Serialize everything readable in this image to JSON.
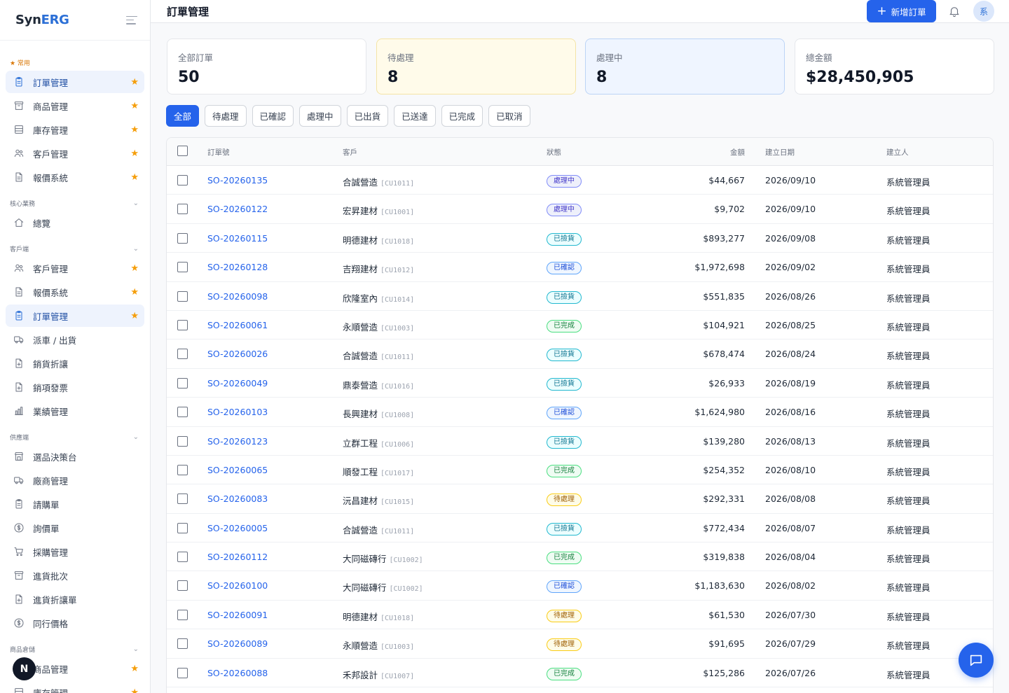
{
  "brand": {
    "prefix": "Syn",
    "accent": "ERG"
  },
  "header": {
    "title": "訂單管理",
    "new_button": "新增訂單",
    "avatar": "系"
  },
  "sidebar": {
    "favorites_title": "★ 常用",
    "favorites": [
      {
        "label": "訂單管理",
        "icon": "clipboard-icon",
        "active": true
      },
      {
        "label": "商品管理",
        "icon": "archive-icon"
      },
      {
        "label": "庫存管理",
        "icon": "warehouse-icon"
      },
      {
        "label": "客戶管理",
        "icon": "users-icon"
      },
      {
        "label": "報價系統",
        "icon": "document-icon"
      }
    ],
    "sections": [
      {
        "title": "核心業務",
        "items": [
          {
            "label": "總覽",
            "icon": "home-icon"
          }
        ]
      },
      {
        "title": "客戶端",
        "items": [
          {
            "label": "客戶管理",
            "icon": "users-icon",
            "star": true
          },
          {
            "label": "報價系統",
            "icon": "document-icon",
            "star": true
          },
          {
            "label": "訂單管理",
            "icon": "clipboard-icon",
            "star": true,
            "active": true
          },
          {
            "label": "派車 / 出貨",
            "icon": "truck-icon"
          },
          {
            "label": "銷貨折讓",
            "icon": "document-plus-icon"
          },
          {
            "label": "銷項發票",
            "icon": "document-plus-icon"
          },
          {
            "label": "業績管理",
            "icon": "bar-chart-icon"
          }
        ]
      },
      {
        "title": "供應端",
        "items": [
          {
            "label": "選品決策台",
            "icon": "store-icon"
          },
          {
            "label": "廠商管理",
            "icon": "truck-icon"
          },
          {
            "label": "請購單",
            "icon": "clipboard-icon"
          },
          {
            "label": "詢價單",
            "icon": "dollar-icon"
          },
          {
            "label": "採購管理",
            "icon": "cart-icon"
          },
          {
            "label": "進貨批次",
            "icon": "archive-icon"
          },
          {
            "label": "進貨折讓單",
            "icon": "document-plus-icon"
          },
          {
            "label": "同行價格",
            "icon": "dollar-icon"
          }
        ]
      },
      {
        "title": "商品倉儲",
        "items": [
          {
            "label": "商品管理",
            "icon": "archive-icon",
            "star": true
          },
          {
            "label": "庫存管理",
            "icon": "warehouse-icon",
            "star": true
          }
        ]
      }
    ],
    "bubble": "N"
  },
  "stats": [
    {
      "label": "全部訂單",
      "value": "50"
    },
    {
      "label": "待處理",
      "value": "8"
    },
    {
      "label": "處理中",
      "value": "8"
    },
    {
      "label": "總金額",
      "value": "$28,450,905"
    }
  ],
  "filters": [
    "全部",
    "待處理",
    "已確認",
    "處理中",
    "已出貨",
    "已送達",
    "已完成",
    "已取消"
  ],
  "table": {
    "columns": {
      "order": "訂單號",
      "customer": "客戶",
      "status": "狀態",
      "amount": "金額",
      "date": "建立日期",
      "creator": "建立人"
    },
    "rows": [
      {
        "order": "SO-20260135",
        "customer": "合誠營造",
        "code": "[CU1011]",
        "status": "處理中",
        "amount": "$44,667",
        "date": "2026/09/10",
        "creator": "系統管理員"
      },
      {
        "order": "SO-20260122",
        "customer": "宏昇建材",
        "code": "[CU1001]",
        "status": "處理中",
        "amount": "$9,702",
        "date": "2026/09/10",
        "creator": "系統管理員"
      },
      {
        "order": "SO-20260115",
        "customer": "明德建材",
        "code": "[CU1018]",
        "status": "已撿貨",
        "amount": "$893,277",
        "date": "2026/09/08",
        "creator": "系統管理員"
      },
      {
        "order": "SO-20260128",
        "customer": "吉翔建材",
        "code": "[CU1012]",
        "status": "已確認",
        "amount": "$1,972,698",
        "date": "2026/09/02",
        "creator": "系統管理員"
      },
      {
        "order": "SO-20260098",
        "customer": "欣隆室內",
        "code": "[CU1014]",
        "status": "已撿貨",
        "amount": "$551,835",
        "date": "2026/08/26",
        "creator": "系統管理員"
      },
      {
        "order": "SO-20260061",
        "customer": "永順營造",
        "code": "[CU1003]",
        "status": "已完成",
        "amount": "$104,921",
        "date": "2026/08/25",
        "creator": "系統管理員"
      },
      {
        "order": "SO-20260026",
        "customer": "合誠營造",
        "code": "[CU1011]",
        "status": "已撿貨",
        "amount": "$678,474",
        "date": "2026/08/24",
        "creator": "系統管理員"
      },
      {
        "order": "SO-20260049",
        "customer": "鼎泰營造",
        "code": "[CU1016]",
        "status": "已撿貨",
        "amount": "$26,933",
        "date": "2026/08/19",
        "creator": "系統管理員"
      },
      {
        "order": "SO-20260103",
        "customer": "長興建材",
        "code": "[CU1008]",
        "status": "已確認",
        "amount": "$1,624,980",
        "date": "2026/08/16",
        "creator": "系統管理員"
      },
      {
        "order": "SO-20260123",
        "customer": "立群工程",
        "code": "[CU1006]",
        "status": "已撿貨",
        "amount": "$139,280",
        "date": "2026/08/13",
        "creator": "系統管理員"
      },
      {
        "order": "SO-20260065",
        "customer": "順發工程",
        "code": "[CU1017]",
        "status": "已完成",
        "amount": "$254,352",
        "date": "2026/08/10",
        "creator": "系統管理員"
      },
      {
        "order": "SO-20260083",
        "customer": "沅昌建材",
        "code": "[CU1015]",
        "status": "待處理",
        "amount": "$292,331",
        "date": "2026/08/08",
        "creator": "系統管理員"
      },
      {
        "order": "SO-20260005",
        "customer": "合誠營造",
        "code": "[CU1011]",
        "status": "已撿貨",
        "amount": "$772,434",
        "date": "2026/08/07",
        "creator": "系統管理員"
      },
      {
        "order": "SO-20260112",
        "customer": "大同磁磚行",
        "code": "[CU1002]",
        "status": "已完成",
        "amount": "$319,838",
        "date": "2026/08/04",
        "creator": "系統管理員"
      },
      {
        "order": "SO-20260100",
        "customer": "大同磁磚行",
        "code": "[CU1002]",
        "status": "已確認",
        "amount": "$1,183,630",
        "date": "2026/08/02",
        "creator": "系統管理員"
      },
      {
        "order": "SO-20260091",
        "customer": "明德建材",
        "code": "[CU1018]",
        "status": "待處理",
        "amount": "$61,530",
        "date": "2026/07/30",
        "creator": "系統管理員"
      },
      {
        "order": "SO-20260089",
        "customer": "永順營造",
        "code": "[CU1003]",
        "status": "待處理",
        "amount": "$91,695",
        "date": "2026/07/29",
        "creator": "系統管理員"
      },
      {
        "order": "SO-20260088",
        "customer": "禾邦設計",
        "code": "[CU1007]",
        "status": "已完成",
        "amount": "$125,286",
        "date": "2026/07/26",
        "creator": "系統管理員"
      }
    ]
  },
  "status_styles": {
    "處理中": "b-processing",
    "已撿貨": "b-picked",
    "已確認": "b-confirmed",
    "已完成": "b-done",
    "待處理": "b-pending"
  },
  "colors": {
    "primary": "#2563eb",
    "star": "#f59e0b",
    "pending_card": "#fffbea",
    "processing_card": "#eff5ff"
  }
}
